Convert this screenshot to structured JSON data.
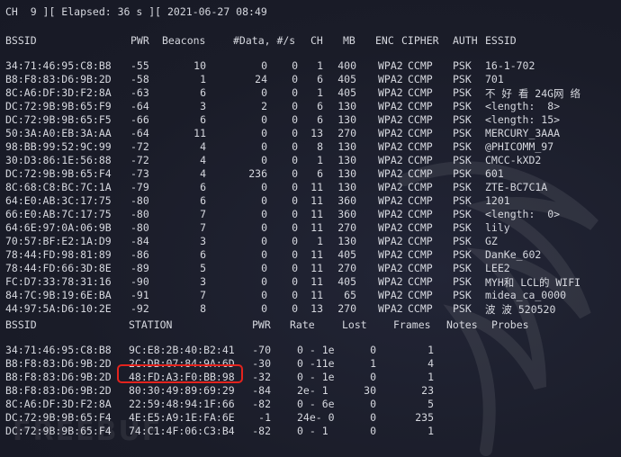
{
  "status_line": "CH  9 ][ Elapsed: 36 s ][ 2021-06-27 08:49",
  "ap_table": {
    "headers": [
      "BSSID",
      "PWR",
      "Beacons",
      "#Data, #/s",
      "CH",
      "MB",
      "ENC",
      "CIPHER",
      "AUTH",
      "ESSID"
    ],
    "rows": [
      [
        "34:71:46:95:C8:B8",
        "-55",
        "10",
        "0",
        "0",
        "1",
        "400",
        "WPA2",
        "CCMP",
        "PSK",
        "16-1-702"
      ],
      [
        "B8:F8:83:D6:9B:2D",
        "-58",
        "1",
        "24",
        "0",
        "6",
        "405",
        "WPA2",
        "CCMP",
        "PSK",
        "701"
      ],
      [
        "8C:A6:DF:3D:F2:8A",
        "-63",
        "6",
        "0",
        "0",
        "1",
        "405",
        "WPA2",
        "CCMP",
        "PSK",
        "不 好 看 24G网 络"
      ],
      [
        "DC:72:9B:9B:65:F9",
        "-64",
        "3",
        "2",
        "0",
        "6",
        "130",
        "WPA2",
        "CCMP",
        "PSK",
        "<length:  8>"
      ],
      [
        "DC:72:9B:9B:65:F5",
        "-66",
        "6",
        "0",
        "0",
        "6",
        "130",
        "WPA2",
        "CCMP",
        "PSK",
        "<length: 15>"
      ],
      [
        "50:3A:A0:EB:3A:AA",
        "-64",
        "11",
        "0",
        "0",
        "13",
        "270",
        "WPA2",
        "CCMP",
        "PSK",
        "MERCURY_3AAA"
      ],
      [
        "98:BB:99:52:9C:99",
        "-72",
        "4",
        "0",
        "0",
        "8",
        "130",
        "WPA2",
        "CCMP",
        "PSK",
        "@PHICOMM_97"
      ],
      [
        "30:D3:86:1E:56:88",
        "-72",
        "4",
        "0",
        "0",
        "1",
        "130",
        "WPA2",
        "CCMP",
        "PSK",
        "CMCC-kXD2"
      ],
      [
        "DC:72:9B:9B:65:F4",
        "-73",
        "4",
        "236",
        "0",
        "6",
        "130",
        "WPA2",
        "CCMP",
        "PSK",
        "601"
      ],
      [
        "8C:68:C8:BC:7C:1A",
        "-79",
        "6",
        "0",
        "0",
        "11",
        "130",
        "WPA2",
        "CCMP",
        "PSK",
        "ZTE-BC7C1A"
      ],
      [
        "64:E0:AB:3C:17:75",
        "-80",
        "6",
        "0",
        "0",
        "11",
        "360",
        "WPA2",
        "CCMP",
        "PSK",
        "1201"
      ],
      [
        "66:E0:AB:7C:17:75",
        "-80",
        "7",
        "0",
        "0",
        "11",
        "360",
        "WPA2",
        "CCMP",
        "PSK",
        "<length:  0>"
      ],
      [
        "64:6E:97:0A:06:9B",
        "-80",
        "7",
        "0",
        "0",
        "11",
        "270",
        "WPA2",
        "CCMP",
        "PSK",
        "lily"
      ],
      [
        "70:57:BF:E2:1A:D9",
        "-84",
        "3",
        "0",
        "0",
        "1",
        "130",
        "WPA2",
        "CCMP",
        "PSK",
        "GZ"
      ],
      [
        "78:44:FD:98:81:89",
        "-86",
        "6",
        "0",
        "0",
        "11",
        "405",
        "WPA2",
        "CCMP",
        "PSK",
        "DanKe_602"
      ],
      [
        "78:44:FD:66:3D:8E",
        "-89",
        "5",
        "0",
        "0",
        "11",
        "270",
        "WPA2",
        "CCMP",
        "PSK",
        "LEE2"
      ],
      [
        "FC:D7:33:78:31:16",
        "-90",
        "3",
        "0",
        "0",
        "11",
        "405",
        "WPA2",
        "CCMP",
        "PSK",
        "MYH和 LCL的 WIFI"
      ],
      [
        "84:7C:9B:19:6E:BA",
        "-91",
        "7",
        "0",
        "0",
        "11",
        "65",
        "WPA2",
        "CCMP",
        "PSK",
        "midea_ca_0000"
      ],
      [
        "44:97:5A:D6:10:2E",
        "-92",
        "8",
        "0",
        "0",
        "13",
        "270",
        "WPA2",
        "CCMP",
        "PSK",
        "波 波 520520"
      ]
    ]
  },
  "station_table": {
    "headers": [
      "BSSID",
      "STATION",
      "PWR",
      "Rate",
      "Lost",
      "Frames",
      "Notes",
      "Probes"
    ],
    "rows": [
      [
        "34:71:46:95:C8:B8",
        "9C:E8:2B:40:B2:41",
        "-70",
        "0 - 1e",
        "0",
        "1"
      ],
      [
        "B8:F8:83:D6:9B:2D",
        "2C:DB:07:84:9A:6D",
        "-30",
        "0 -11e",
        "1",
        "4"
      ],
      [
        "B8:F8:83:D6:9B:2D",
        "48:FD:A3:F0:BB:98",
        "-32",
        "0 - 1e",
        "0",
        "1"
      ],
      [
        "B8:F8:83:D6:9B:2D",
        "80:30:49:89:69:29",
        "-84",
        "2e- 1",
        "30",
        "23"
      ],
      [
        "8C:A6:DF:3D:F2:8A",
        "22:59:48:94:1F:66",
        "-82",
        "0 - 6e",
        "0",
        "5"
      ],
      [
        "DC:72:9B:9B:65:F4",
        "4E:E5:A9:1E:FA:6E",
        "-1",
        "24e- 0",
        "0",
        "235"
      ],
      [
        "DC:72:9B:9B:65:F4",
        "74:C1:4F:06:C3:B4",
        "-82",
        "0 - 1",
        "0",
        "1"
      ]
    ]
  },
  "watermark": "FREEBUF",
  "highlight_color": "#e3231d",
  "text_color": "#d6d8df",
  "background_color": "#1b1d2a"
}
